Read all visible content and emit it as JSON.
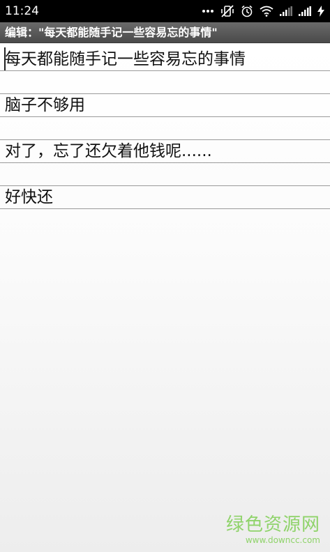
{
  "status_bar": {
    "time": "11:24",
    "icons": [
      "more-dots-icon",
      "vibrate-off-icon",
      "alarm-icon",
      "wifi-icon",
      "signal-icon",
      "signal-icon",
      "charging-icon"
    ],
    "background": "#000000"
  },
  "title_bar": {
    "title": "编辑：\"每天都能随手记一些容易忘的事情\"",
    "background": "#555555"
  },
  "note": {
    "lines": [
      "每天都能随手记一些容易忘的事情",
      "脑子不够用",
      "对了，忘了还欠着他钱呢......",
      "好快还"
    ]
  },
  "watermark": {
    "main": "绿色资源网",
    "sub": "www.downcc.com",
    "color": "#8fd36a"
  }
}
